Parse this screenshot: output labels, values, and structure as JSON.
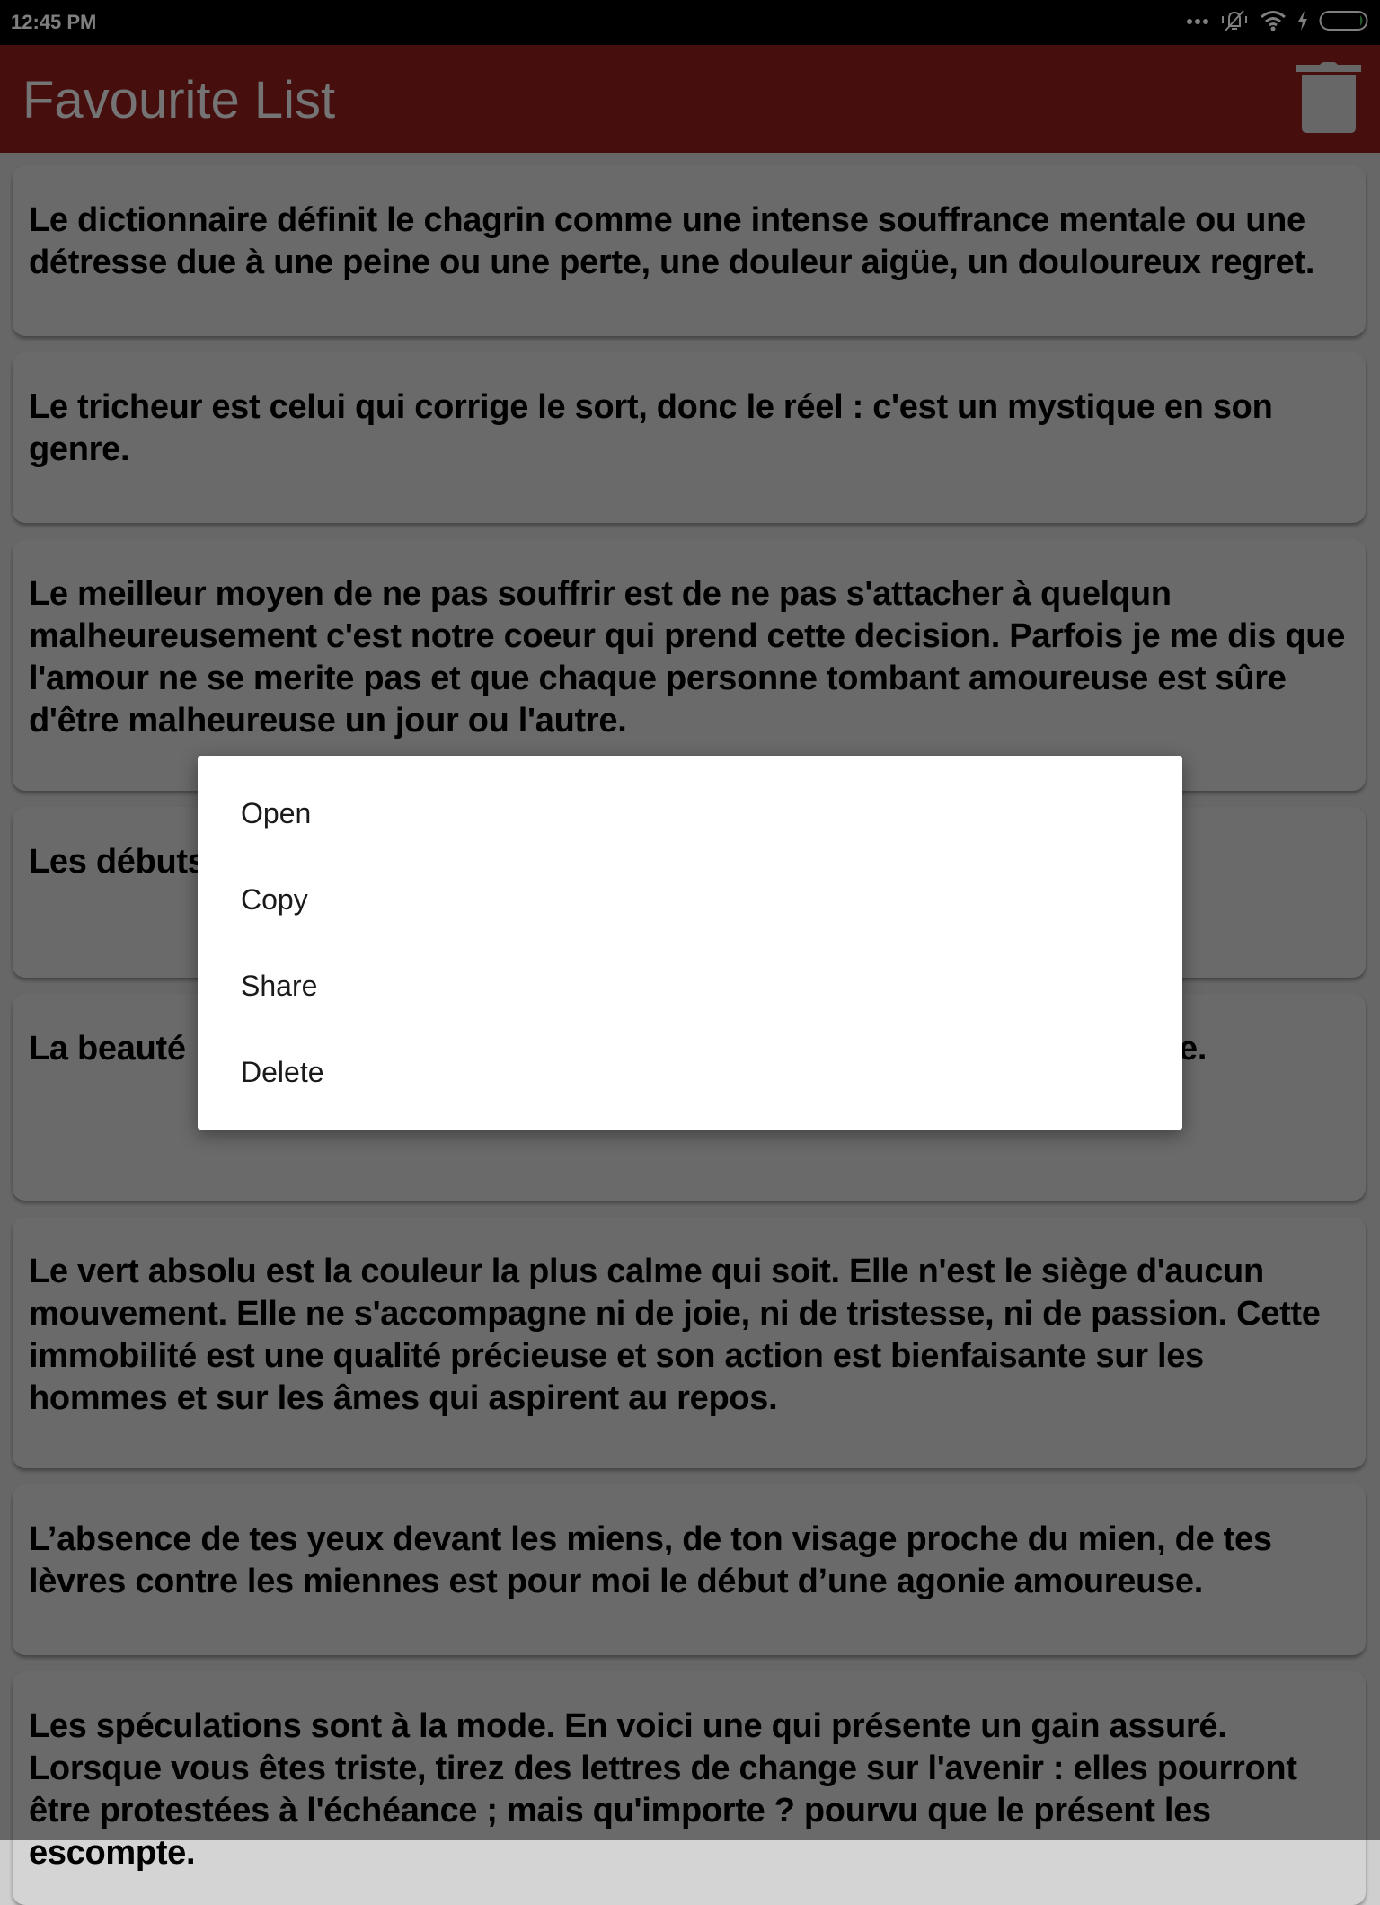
{
  "status_bar": {
    "time": "12:45 PM",
    "icons": [
      "more-dots-icon",
      "vibrate-off-icon",
      "wifi-icon",
      "charging-icon",
      "battery-icon"
    ],
    "battery_color": "#4caf50"
  },
  "app_bar": {
    "title": "Favourite List",
    "delete_all_icon": "trash-icon",
    "color": "#8f1c1c"
  },
  "quotes": [
    "Le dictionnaire définit le chagrin comme une intense souffrance mentale ou une détresse due à une peine ou une perte, une douleur aigüe, un douloureux regret.",
    " Le tricheur est celui qui corrige le sort, donc le réel : c'est un mystique en son genre.",
    "Le meilleur moyen de ne pas souffrir est de ne pas s'attacher à quelqun malheureusement c'est notre coeur qui prend cette decision. Parfois je me dis que l'amour ne se merite pas et que chaque personne tombant amoureuse est sûre d'être malheureuse un jour ou l'autre.",
    "Les débuts … ristes, mais c’est … écue",
    "La beauté … ours quelque ch… pas. Que je dois en profiter. M'en repaître.",
    "Le vert absolu est la couleur la plus calme qui soit. Elle n'est le siège d'aucun mouvement. Elle ne s'accompagne ni de joie, ni de tristesse, ni de passion. Cette immobilité est une qualité précieuse et son action est bienfaisante sur les hommes et sur les âmes qui aspirent au repos.",
    "L’absence de tes yeux devant les miens, de ton visage proche du mien, de tes lèvres contre les miennes est pour moi le début d’une agonie amoureuse.",
    "Les spéculations sont à la mode. En voici une qui présente un gain assuré. Lorsque vous êtes triste, tirez des lettres de change sur l'avenir : elles pourront être protestées à l'échéance ; mais qu'importe ? pourvu que le présent les escompte."
  ],
  "context_menu": {
    "items": [
      "Open",
      "Copy",
      "Share",
      "Delete"
    ]
  }
}
